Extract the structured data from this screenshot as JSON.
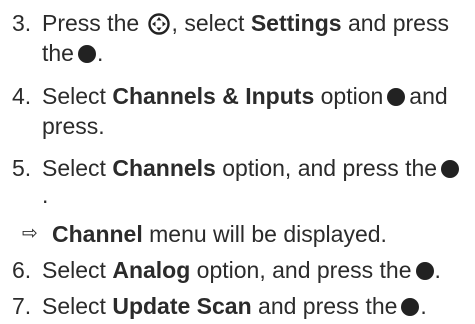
{
  "steps": [
    {
      "num": "3.",
      "l1a": "Press the",
      "l1b": ", select",
      "l1c": "Settings",
      "l1d": "and press",
      "l2a": "the",
      "l2b": "."
    },
    {
      "num": "4.",
      "l1a": "Select",
      "l1b": "Channels & Inputs",
      "l1c": "option",
      "l1d": "and",
      "l2a": "press."
    },
    {
      "num": "5.",
      "l1a": "Select",
      "l1b": "Channels",
      "l1c": "option, and press the",
      "l2a": "."
    },
    {
      "arrow": "⇨",
      "bold": "Channel",
      "rest": "menu will be displayed."
    },
    {
      "num": "6.",
      "l1a": "Select",
      "l1b": "Analog",
      "l1c": "option, and press the",
      "l1d": "."
    },
    {
      "num": "7.",
      "l1a": "Select",
      "l1b": "Update Scan",
      "l1c": "and press the",
      "l1d": "."
    }
  ],
  "icons": {
    "nav": "navigation-pad-icon",
    "ok": "ok-button-icon"
  }
}
